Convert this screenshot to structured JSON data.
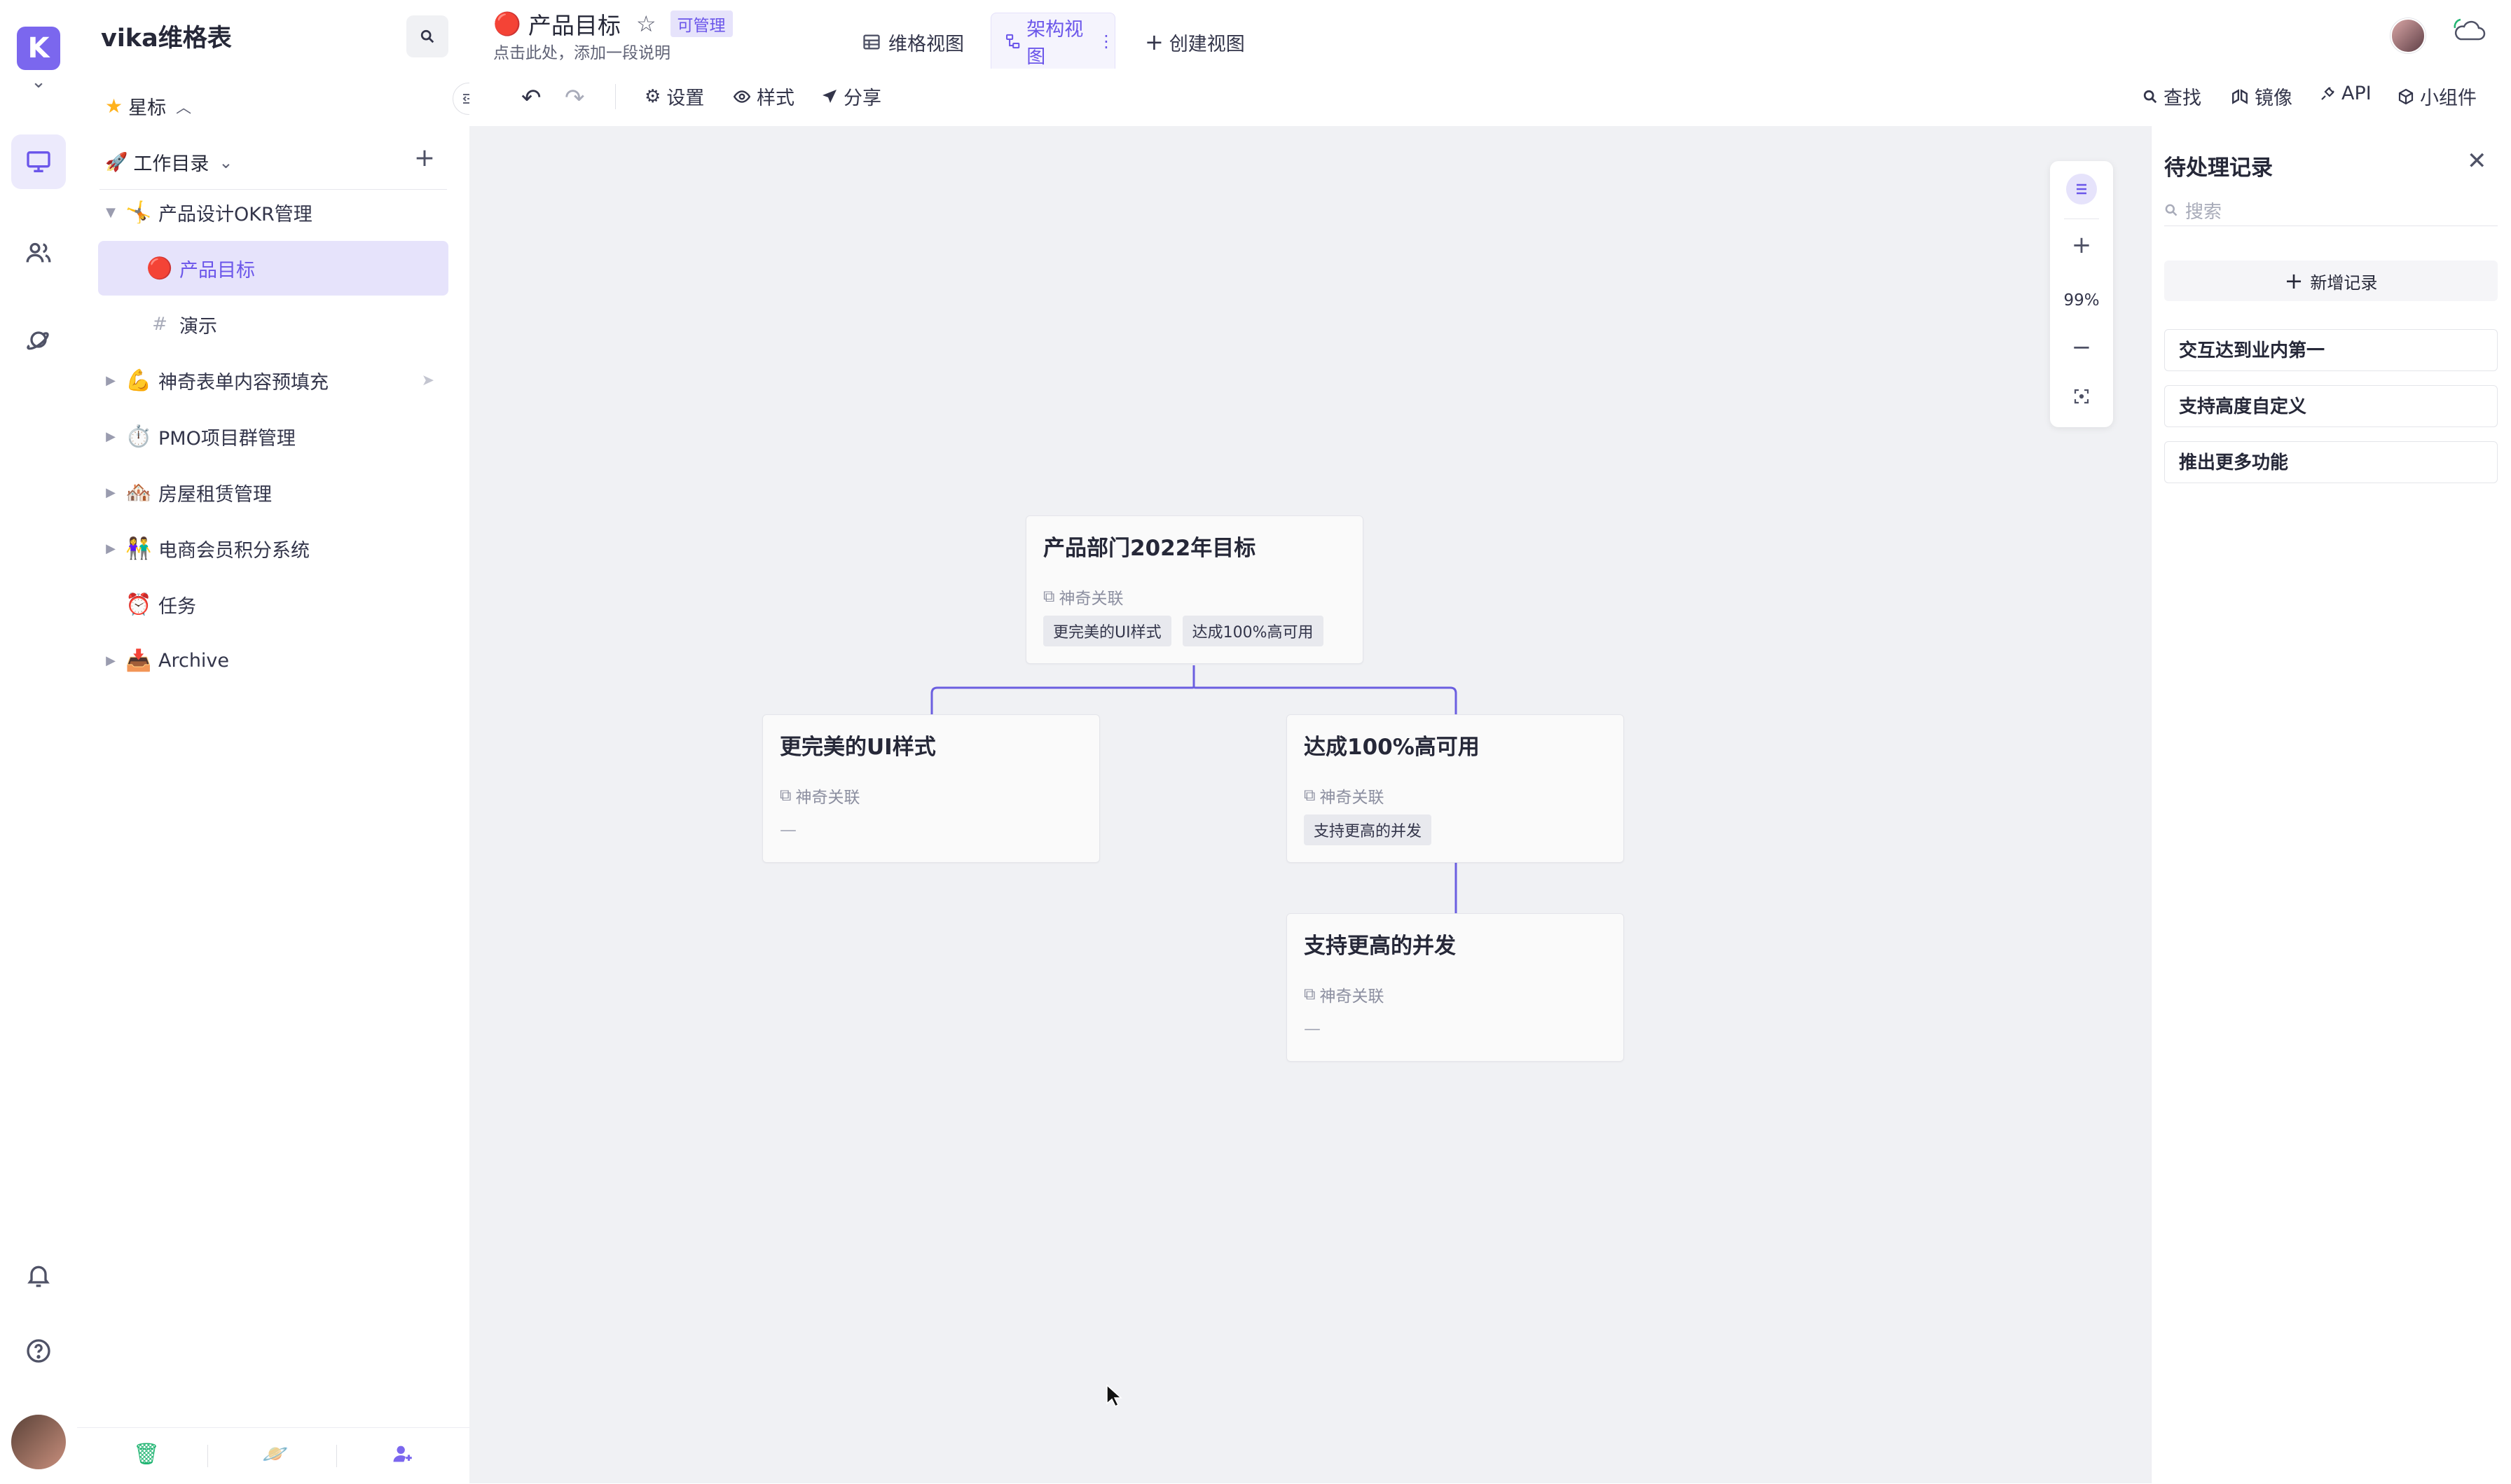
{
  "app": {
    "workspace_name": "vika维格表",
    "starred_label": "星标",
    "catalog_label": "工作目录"
  },
  "tree": [
    {
      "label": "产品设计OKR管理",
      "emoji": "🤸",
      "expanded": true,
      "depth": 0,
      "active": false
    },
    {
      "label": "产品目标",
      "emoji": "🔴",
      "expanded": null,
      "depth": 1,
      "active": true
    },
    {
      "label": "演示",
      "emoji": "#",
      "expanded": null,
      "depth": 1,
      "active": false
    },
    {
      "label": "神奇表单内容预填充",
      "emoji": "💪",
      "expanded": false,
      "depth": 0,
      "active": false
    },
    {
      "label": "PMO项目群管理",
      "emoji": "⏱️",
      "expanded": false,
      "depth": 0,
      "active": false
    },
    {
      "label": "房屋租赁管理",
      "emoji": "🏘️",
      "expanded": false,
      "depth": 0,
      "active": false
    },
    {
      "label": "电商会员积分系统",
      "emoji": "👫",
      "expanded": false,
      "depth": 0,
      "active": false
    },
    {
      "label": "任务",
      "emoji": "⏰",
      "expanded": null,
      "depth": 0,
      "active": false
    },
    {
      "label": "Archive",
      "emoji": "📥",
      "expanded": false,
      "depth": 0,
      "active": false
    }
  ],
  "header": {
    "title": "产品目标",
    "title_emoji": "🔴",
    "permission_badge": "可管理",
    "description_placeholder": "点击此处，添加一段说明",
    "tabs": [
      {
        "label": "维格视图",
        "active": false
      },
      {
        "label": "架构视图",
        "active": true
      }
    ],
    "create_view_label": "创建视图"
  },
  "toolbar": {
    "settings_label": "设置",
    "style_label": "样式",
    "share_label": "分享",
    "find_label": "查找",
    "mirror_label": "镜像",
    "api_label": "API",
    "widget_label": "小组件"
  },
  "zoom": {
    "level": "99%"
  },
  "cards": {
    "root": {
      "title": "产品部门2022年目标",
      "field": "神奇关联",
      "tags": [
        "更完美的UI样式",
        "达成100%高可用"
      ]
    },
    "left": {
      "title": "更完美的UI样式",
      "field": "神奇关联",
      "empty": "—"
    },
    "right": {
      "title": "达成100%高可用",
      "field": "神奇关联",
      "tags": [
        "支持更高的并发"
      ]
    },
    "child": {
      "title": "支持更高的并发",
      "field": "神奇关联",
      "empty": "—"
    }
  },
  "pending_panel": {
    "title": "待处理记录",
    "search_placeholder": "搜索",
    "add_record_label": "新增记录",
    "records": [
      "交互达到业内第一",
      "支持高度自定义",
      "推出更多功能"
    ]
  },
  "colors": {
    "accent": "#7b67ee",
    "connector": "#6b5fe0",
    "canvas_bg": "#f0f1f4",
    "badge_bg": "#e6e3fb"
  }
}
